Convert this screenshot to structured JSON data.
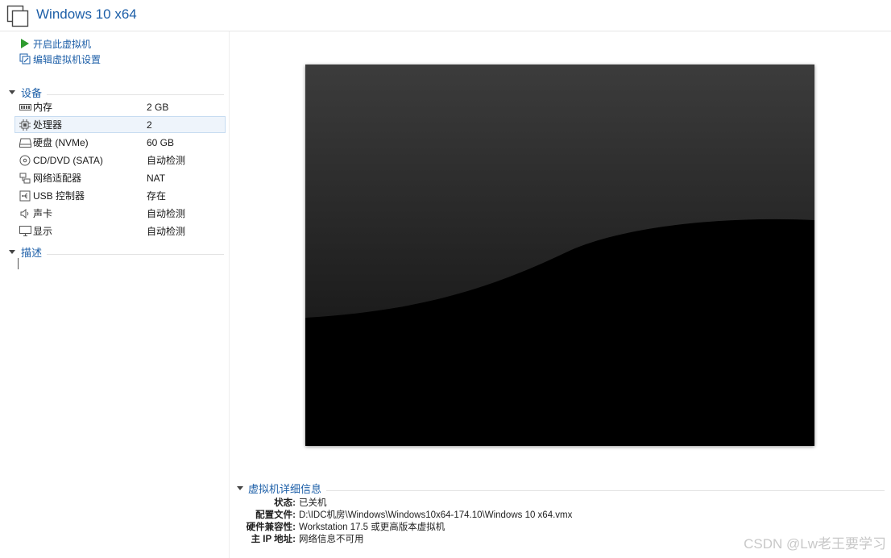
{
  "window": {
    "title": "Windows 10 x64"
  },
  "actions": [
    {
      "label": "开启此虚拟机",
      "icon": "play-icon"
    },
    {
      "label": "编辑虚拟机设置",
      "icon": "edit-settings-icon"
    }
  ],
  "devices": {
    "heading": "设备",
    "items": [
      {
        "name": "内存",
        "value": "2 GB",
        "icon": "memory-icon"
      },
      {
        "name": "处理器",
        "value": "2",
        "icon": "processor-icon",
        "selected": true
      },
      {
        "name": "硬盘 (NVMe)",
        "value": "60 GB",
        "icon": "hard-disk-icon"
      },
      {
        "name": "CD/DVD (SATA)",
        "value": "自动检测",
        "icon": "cd-dvd-icon"
      },
      {
        "name": "网络适配器",
        "value": "NAT",
        "icon": "network-adapter-icon"
      },
      {
        "name": "USB 控制器",
        "value": "存在",
        "icon": "usb-controller-icon"
      },
      {
        "name": "声卡",
        "value": "自动检测",
        "icon": "sound-card-icon"
      },
      {
        "name": "显示",
        "value": "自动检测",
        "icon": "display-icon"
      }
    ]
  },
  "description": {
    "heading": "描述"
  },
  "details": {
    "heading": "虚拟机详细信息",
    "rows": [
      {
        "label": "状态:",
        "value": "已关机"
      },
      {
        "label": "配置文件:",
        "value": "D:\\IDC机房\\Windows\\Windows10x64-174.10\\Windows 10 x64.vmx"
      },
      {
        "label": "硬件兼容性:",
        "value": "Workstation 17.5 或更高版本虚拟机"
      },
      {
        "label": "主 IP 地址:",
        "value": "网络信息不可用"
      }
    ]
  },
  "watermark": "CSDN @Lw老王要学习",
  "colors": {
    "accent": "#1d5fa8",
    "play": "#2e9b2e",
    "screen": "#000000"
  }
}
